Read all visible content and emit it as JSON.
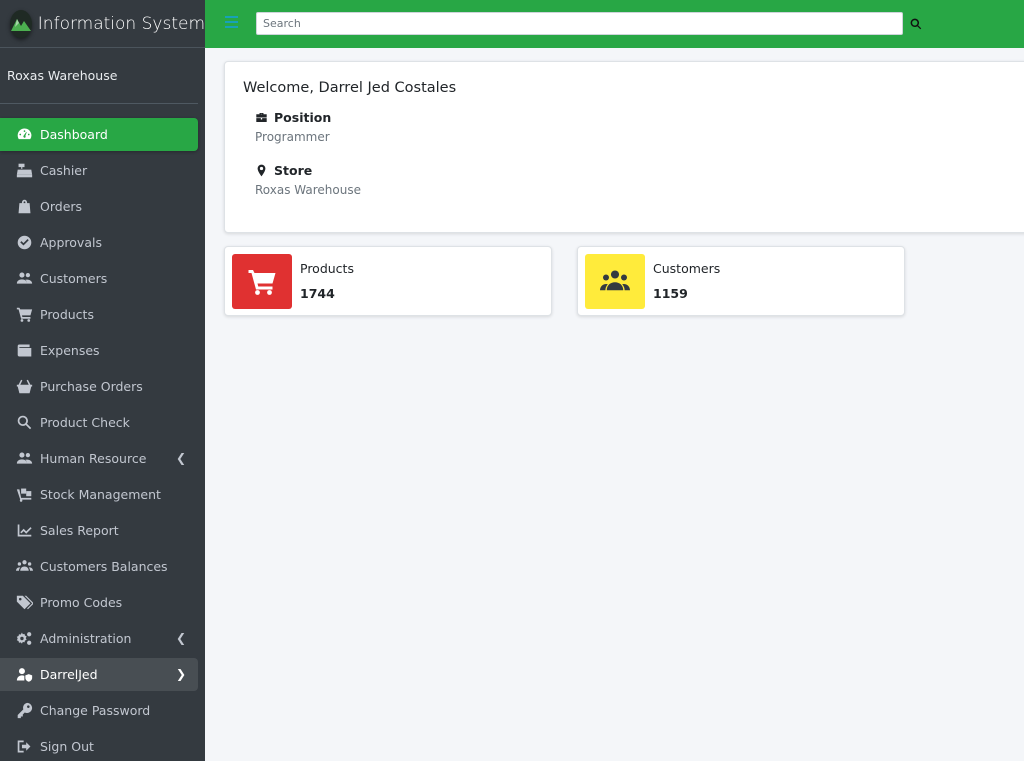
{
  "app": {
    "title": "Information System"
  },
  "user_panel": {
    "store_name": "Roxas Warehouse"
  },
  "sidebar": {
    "items": [
      {
        "label": "Dashboard",
        "icon": "tachometer-icon"
      },
      {
        "label": "Cashier",
        "icon": "cash-register-icon"
      },
      {
        "label": "Orders",
        "icon": "shopping-bag-icon"
      },
      {
        "label": "Approvals",
        "icon": "check-circle-icon"
      },
      {
        "label": "Customers",
        "icon": "users-icon"
      },
      {
        "label": "Products",
        "icon": "shopping-cart-icon"
      },
      {
        "label": "Expenses",
        "icon": "wallet-icon"
      },
      {
        "label": "Purchase Orders",
        "icon": "basket-icon"
      },
      {
        "label": "Product Check",
        "icon": "search-icon"
      },
      {
        "label": "Human Resource",
        "icon": "users-icon"
      },
      {
        "label": "Stock Management",
        "icon": "dolly-icon"
      },
      {
        "label": "Sales Report",
        "icon": "chart-line-icon"
      },
      {
        "label": "Customers Balances",
        "icon": "users-group-icon"
      },
      {
        "label": "Promo Codes",
        "icon": "tags-icon"
      },
      {
        "label": "Administration",
        "icon": "cogs-icon"
      },
      {
        "label": "DarrelJed",
        "icon": "user-shield-icon"
      },
      {
        "label": "Change Password",
        "icon": "key-icon"
      },
      {
        "label": "Sign Out",
        "icon": "sign-out-icon"
      }
    ]
  },
  "search": {
    "placeholder": "Search"
  },
  "welcome": {
    "greeting": "Welcome, Darrel Jed Costales",
    "position_label": "Position",
    "position_value": "Programmer",
    "store_label": "Store",
    "store_value": "Roxas Warehouse"
  },
  "stats": [
    {
      "label": "Products",
      "value": "1744",
      "color": "#dc3545",
      "icon": "shopping-cart-icon"
    },
    {
      "label": "Customers",
      "value": "1159",
      "color": "#ffeb3b",
      "icon": "users-icon"
    }
  ],
  "colors": {
    "accent": "#28a745",
    "sidebar_bg": "#343a40",
    "background": "#f4f6f9"
  }
}
